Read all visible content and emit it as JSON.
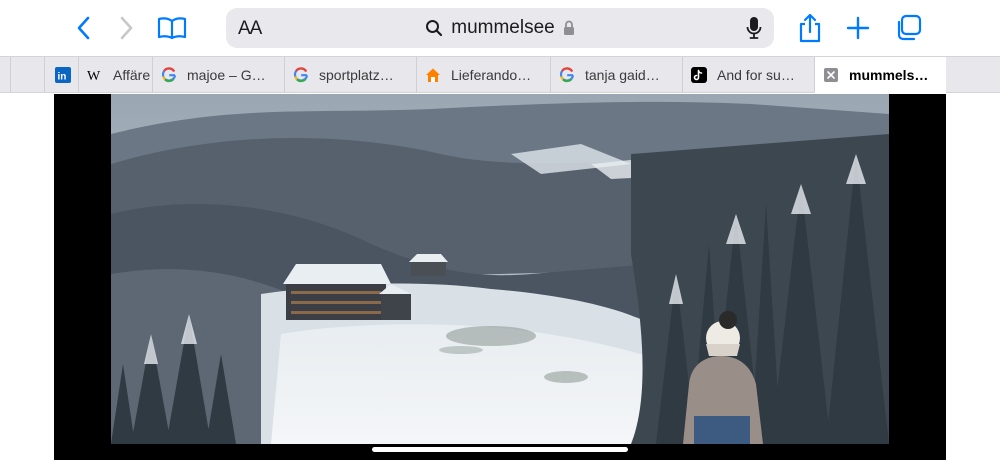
{
  "toolbar": {
    "back_icon": "chevron-left-icon",
    "forward_icon": "chevron-right-icon",
    "bookmarks_icon": "book-icon",
    "share_icon": "share-icon",
    "new_tab_icon": "plus-icon",
    "tabs_icon": "tabs-icon",
    "accent_color": "#007aff"
  },
  "addressbar": {
    "reader_label": "AA",
    "url": "mummelsee",
    "search_icon": "magnifier-icon",
    "lock_icon": "lock-icon",
    "mic_icon": "microphone-icon"
  },
  "tabs": [
    {
      "label": "",
      "icon": "linkedin-icon"
    },
    {
      "label": "Affäre",
      "icon": "wikipedia-icon"
    },
    {
      "label": "majoe – G…",
      "icon": "google-icon"
    },
    {
      "label": "sportplatz…",
      "icon": "google-icon"
    },
    {
      "label": "Lieferando…",
      "icon": "lieferando-icon"
    },
    {
      "label": "tanja gaid…",
      "icon": "google-icon"
    },
    {
      "label": "And for su…",
      "icon": "tiktok-icon"
    },
    {
      "label": "mummels…",
      "icon": "close-tab-icon",
      "active": true
    }
  ],
  "video": {
    "description_icon": "winter-lake-photo"
  }
}
